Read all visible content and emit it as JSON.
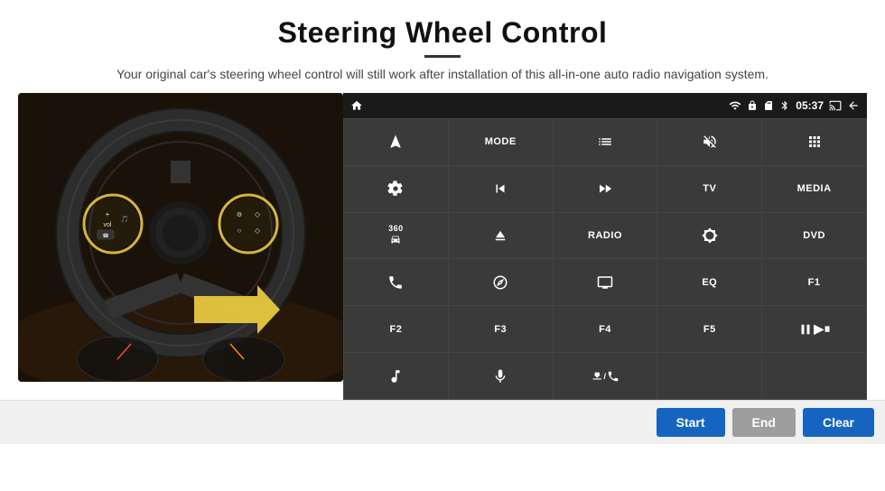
{
  "header": {
    "title": "Steering Wheel Control",
    "description": "Your original car's steering wheel control will still work after installation of this all-in-one auto radio navigation system."
  },
  "status_bar": {
    "time": "05:37",
    "icons": [
      "wifi",
      "lock",
      "sd-card",
      "bluetooth",
      "battery",
      "cast",
      "back"
    ]
  },
  "grid_buttons": [
    {
      "id": "r1c1",
      "type": "icon",
      "icon": "home"
    },
    {
      "id": "r1c2",
      "type": "text",
      "label": "MODE"
    },
    {
      "id": "r1c3",
      "type": "icon",
      "icon": "list"
    },
    {
      "id": "r1c4",
      "type": "icon",
      "icon": "mute"
    },
    {
      "id": "r1c5",
      "type": "icon",
      "icon": "apps"
    },
    {
      "id": "r2c1",
      "type": "icon",
      "icon": "settings-circle"
    },
    {
      "id": "r2c2",
      "type": "icon",
      "icon": "rewind"
    },
    {
      "id": "r2c3",
      "type": "icon",
      "icon": "fast-forward"
    },
    {
      "id": "r2c4",
      "type": "text",
      "label": "TV"
    },
    {
      "id": "r2c5",
      "type": "text",
      "label": "MEDIA"
    },
    {
      "id": "r3c1",
      "type": "icon",
      "icon": "360-car"
    },
    {
      "id": "r3c2",
      "type": "icon",
      "icon": "eject"
    },
    {
      "id": "r3c3",
      "type": "text",
      "label": "RADIO"
    },
    {
      "id": "r3c4",
      "type": "icon",
      "icon": "brightness"
    },
    {
      "id": "r3c5",
      "type": "text",
      "label": "DVD"
    },
    {
      "id": "r4c1",
      "type": "icon",
      "icon": "phone"
    },
    {
      "id": "r4c2",
      "type": "icon",
      "icon": "navigation"
    },
    {
      "id": "r4c3",
      "type": "icon",
      "icon": "display"
    },
    {
      "id": "r4c4",
      "type": "text",
      "label": "EQ"
    },
    {
      "id": "r4c5",
      "type": "text",
      "label": "F1"
    },
    {
      "id": "r5c1",
      "type": "text",
      "label": "F2"
    },
    {
      "id": "r5c2",
      "type": "text",
      "label": "F3"
    },
    {
      "id": "r5c3",
      "type": "text",
      "label": "F4"
    },
    {
      "id": "r5c4",
      "type": "text",
      "label": "F5"
    },
    {
      "id": "r5c5",
      "type": "icon",
      "icon": "play-pause"
    },
    {
      "id": "r6c1",
      "type": "icon",
      "icon": "music"
    },
    {
      "id": "r6c2",
      "type": "icon",
      "icon": "mic"
    },
    {
      "id": "r6c3",
      "type": "icon",
      "icon": "volume-call"
    },
    {
      "id": "r6c4",
      "type": "empty",
      "label": ""
    },
    {
      "id": "r6c5",
      "type": "empty",
      "label": ""
    }
  ],
  "bottom_buttons": {
    "start_label": "Start",
    "end_label": "End",
    "clear_label": "Clear"
  }
}
